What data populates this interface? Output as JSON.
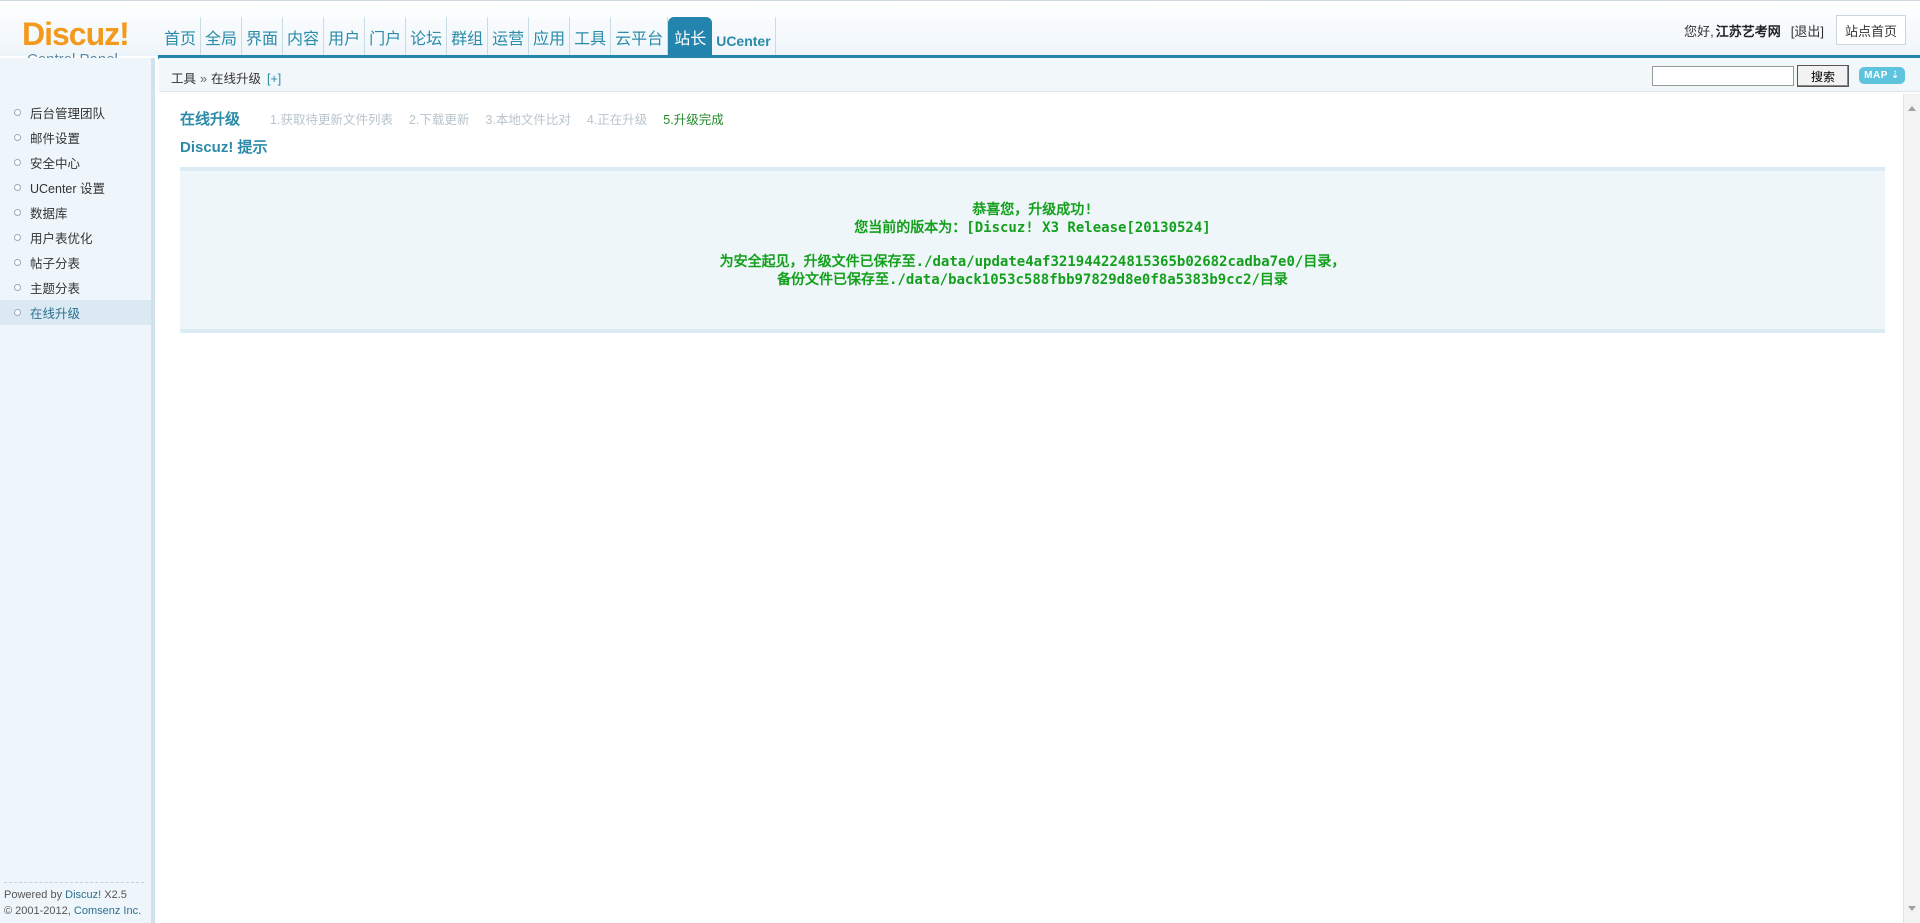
{
  "logo": {
    "brand": "Discuz!",
    "subtitle": "Control Panel"
  },
  "nav": {
    "items": [
      "首页",
      "全局",
      "界面",
      "内容",
      "用户",
      "门户",
      "论坛",
      "群组",
      "运营",
      "应用",
      "工具",
      "云平台",
      "站长",
      "UCenter"
    ],
    "active": "站长"
  },
  "user": {
    "greeting": "您好,",
    "name": "江苏艺考网",
    "logout": "[退出]",
    "home": "站点首页"
  },
  "sidebar": {
    "items": [
      {
        "label": "后台管理团队"
      },
      {
        "label": "邮件设置"
      },
      {
        "label": "安全中心"
      },
      {
        "label": "UCenter 设置"
      },
      {
        "label": "数据库"
      },
      {
        "label": "用户表优化"
      },
      {
        "label": "帖子分表"
      },
      {
        "label": "主题分表"
      },
      {
        "label": "在线升级"
      }
    ],
    "active": "在线升级",
    "footer": {
      "powered": "Powered by",
      "product": "Discuz!",
      "version": "X2.5",
      "copyright": "© 2001-2012,",
      "company": "Comsenz Inc."
    }
  },
  "breadcrumb": {
    "root": "工具",
    "sep": "»",
    "current": "在线升级",
    "plus": "[+]"
  },
  "search": {
    "button": "搜索",
    "value": ""
  },
  "map_button": "MAP ⇣",
  "steps": {
    "title": "在线升级",
    "items": [
      "1.获取待更新文件列表",
      "2.下载更新",
      "3.本地文件比对",
      "4.正在升级",
      "5.升级完成"
    ],
    "current_index": 4
  },
  "tip": {
    "title": "Discuz! 提示",
    "lines": [
      "恭喜您，升级成功!",
      "您当前的版本为：[Discuz! X3 Release[20130524]",
      "为安全起见，升级文件已保存至./data/update4af321944224815365b02682cadba7e0/目录，",
      "备份文件已保存至./data/back1053c588fbb97829d8e0f8a5383b9cc2/目录"
    ]
  },
  "colors": {
    "accent": "#2384ad",
    "logo": "#f39a1e",
    "success": "#14a01c",
    "link": "#2b8ba8"
  }
}
